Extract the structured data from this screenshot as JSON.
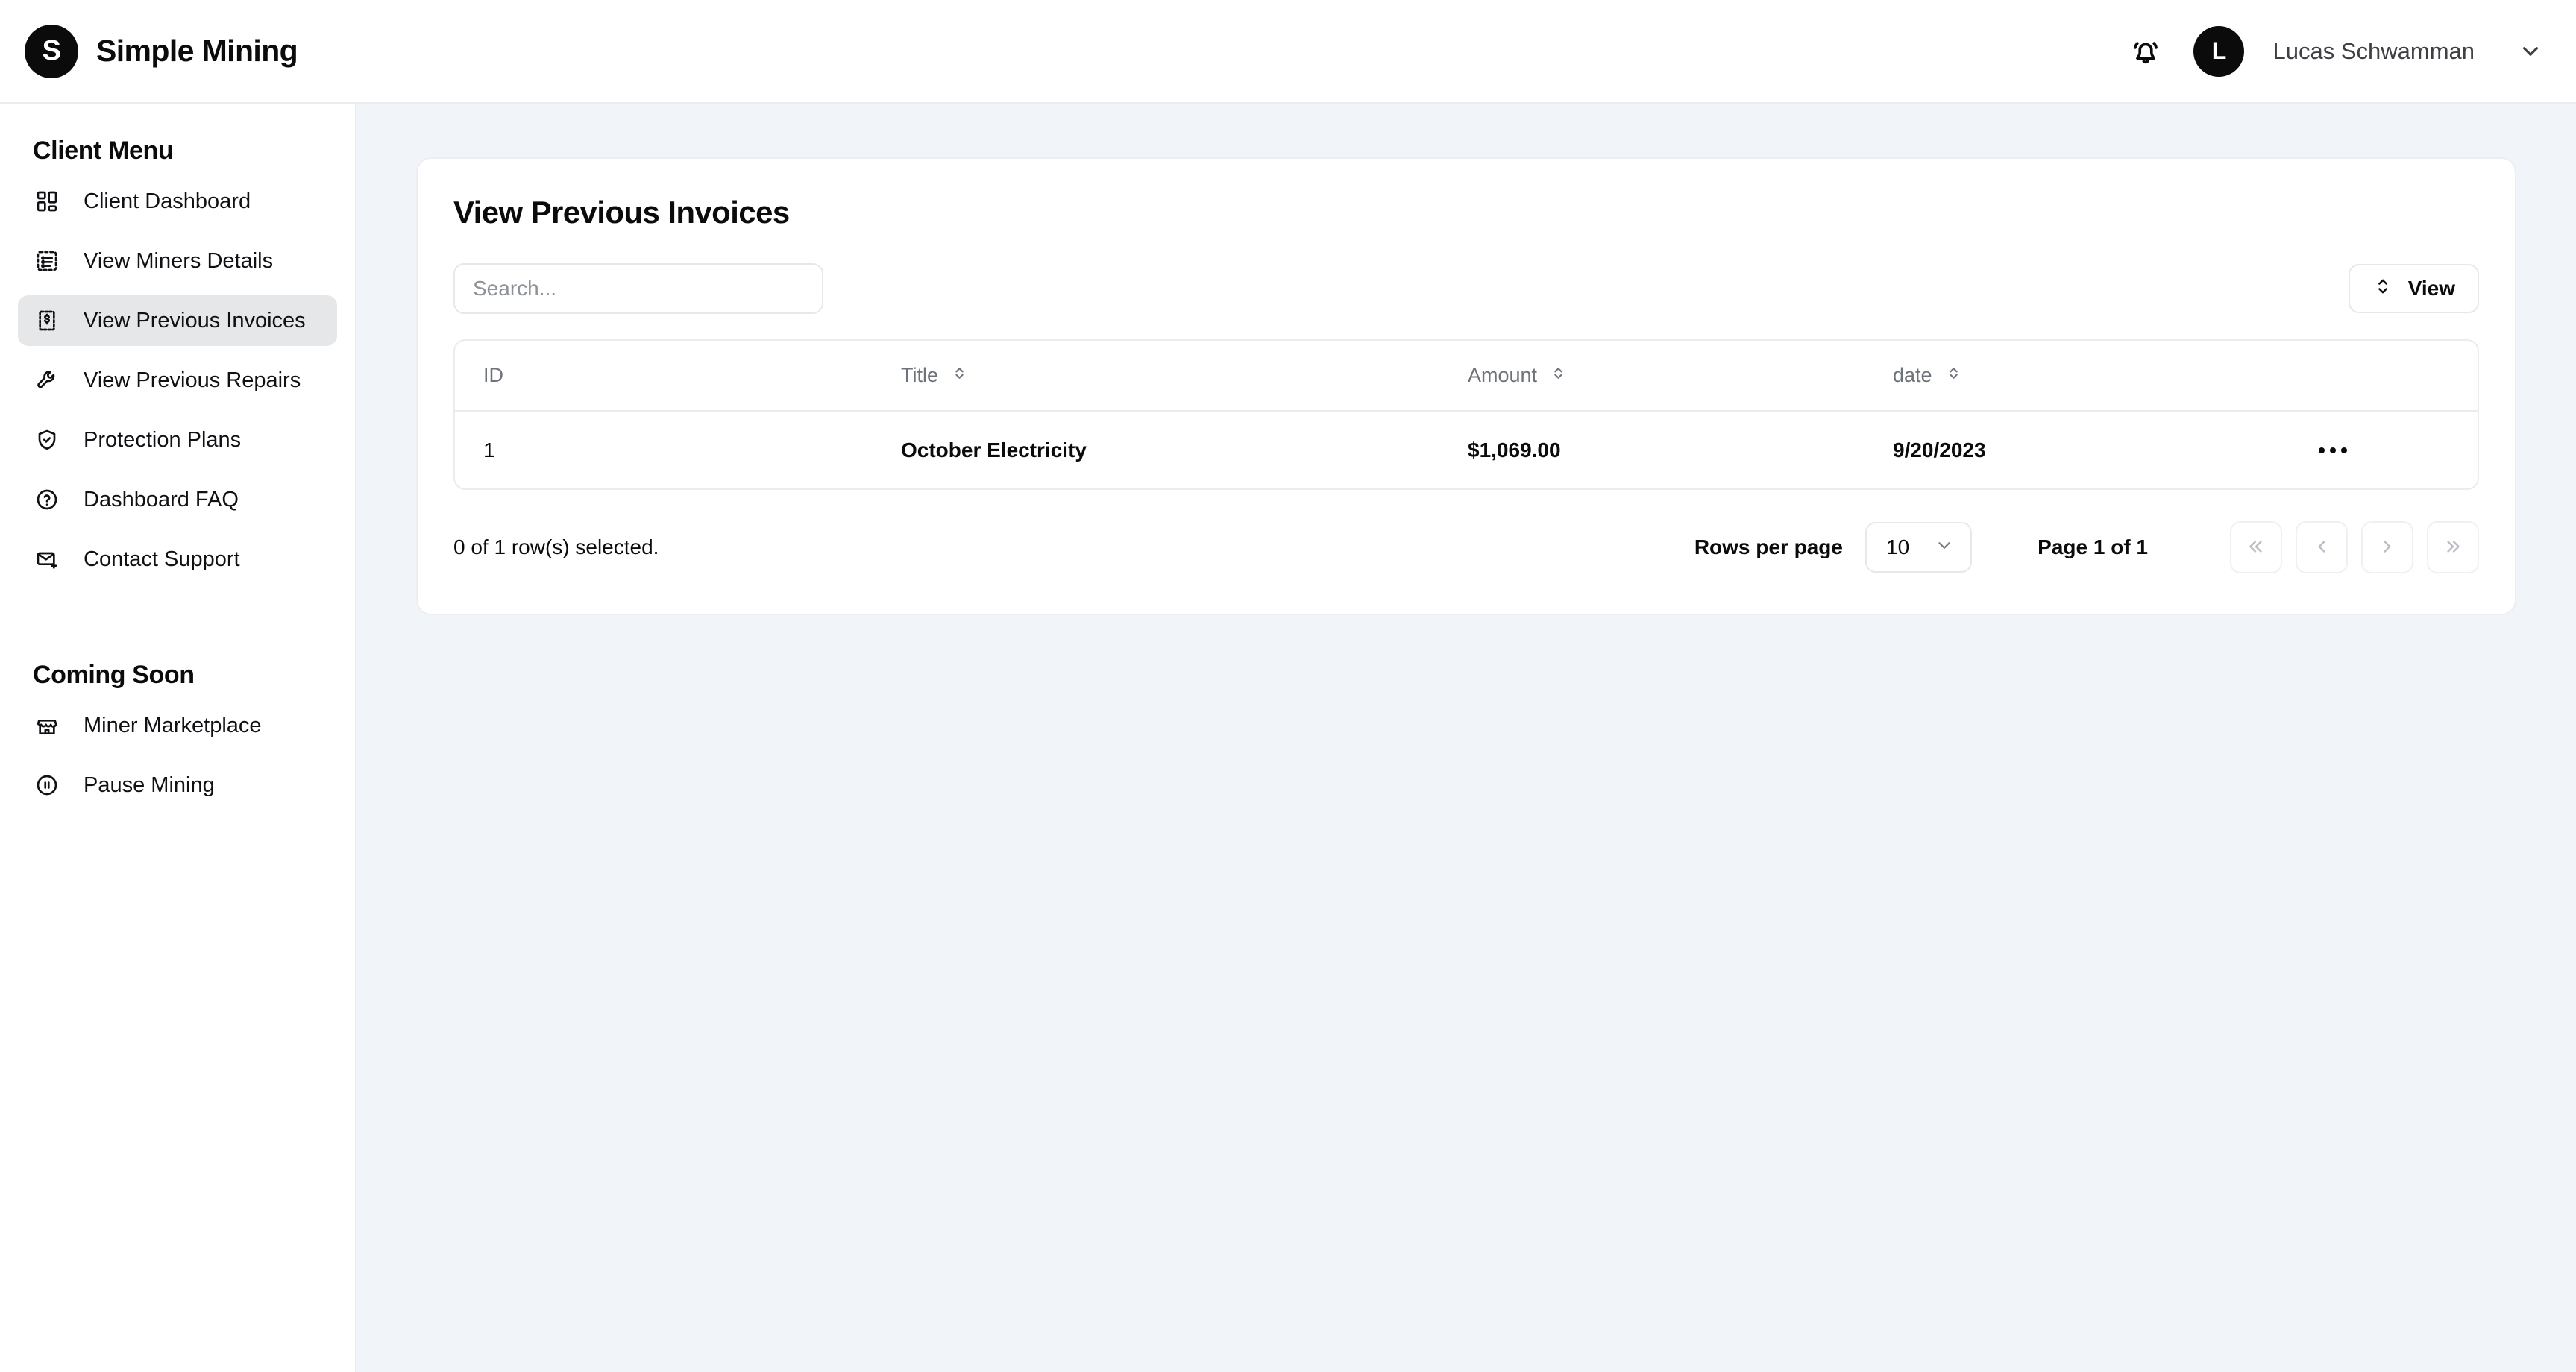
{
  "topbar": {
    "logo_letter": "S",
    "brand_name": "Simple Mining",
    "notification_icon": "bell-ringing-icon",
    "avatar_letter": "L",
    "user_name": "Lucas Schwamman",
    "user_chevron_icon": "chevron-down-icon"
  },
  "sidebar": {
    "client_menu_heading": "Client Menu",
    "coming_soon_heading": "Coming Soon",
    "items": [
      {
        "label": "Client Dashboard",
        "icon": "layout-grid-icon",
        "active": false
      },
      {
        "label": "View Miners Details",
        "icon": "list-details-icon",
        "active": false
      },
      {
        "label": "View Previous Invoices",
        "icon": "receipt-dollar-icon",
        "active": true
      },
      {
        "label": "View Previous Repairs",
        "icon": "wrench-icon",
        "active": false
      },
      {
        "label": "Protection Plans",
        "icon": "shield-check-icon",
        "active": false
      },
      {
        "label": "Dashboard FAQ",
        "icon": "question-circle-icon",
        "active": false
      },
      {
        "label": "Contact Support",
        "icon": "mail-plus-icon",
        "active": false
      }
    ],
    "coming_soon_items": [
      {
        "label": "Miner Marketplace",
        "icon": "store-icon"
      },
      {
        "label": "Pause Mining",
        "icon": "pause-circle-icon"
      }
    ]
  },
  "main": {
    "card_title": "View Previous Invoices",
    "search": {
      "placeholder": "Search...",
      "value": ""
    },
    "view_button": {
      "label": "View",
      "icon": "chevrons-up-down-icon"
    },
    "table": {
      "columns": [
        {
          "key": "id",
          "label": "ID",
          "sortable": false
        },
        {
          "key": "title",
          "label": "Title",
          "sortable": true
        },
        {
          "key": "amount",
          "label": "Amount",
          "sortable": true
        },
        {
          "key": "date",
          "label": "date",
          "sortable": true
        }
      ],
      "rows": [
        {
          "id": "1",
          "title": "October Electricity",
          "amount": "$1,069.00",
          "date": "9/20/2023"
        }
      ]
    },
    "footer": {
      "rows_selected": "0 of 1 row(s) selected.",
      "rows_per_page_label": "Rows per page",
      "rows_per_page_value": "10",
      "page_indicator": "Page 1 of 1",
      "pager": [
        {
          "name": "first-page",
          "icon": "chevrons-left-icon"
        },
        {
          "name": "previous-page",
          "icon": "chevron-left-icon"
        },
        {
          "name": "next-page",
          "icon": "chevron-right-icon"
        },
        {
          "name": "last-page",
          "icon": "chevrons-right-icon"
        }
      ]
    }
  },
  "colors": {
    "accent": "#0b0b0c",
    "main_background": "#f1f4f8",
    "active_item_background": "#e6e7e9",
    "border": "#ececef",
    "muted_text": "#6e727a"
  }
}
